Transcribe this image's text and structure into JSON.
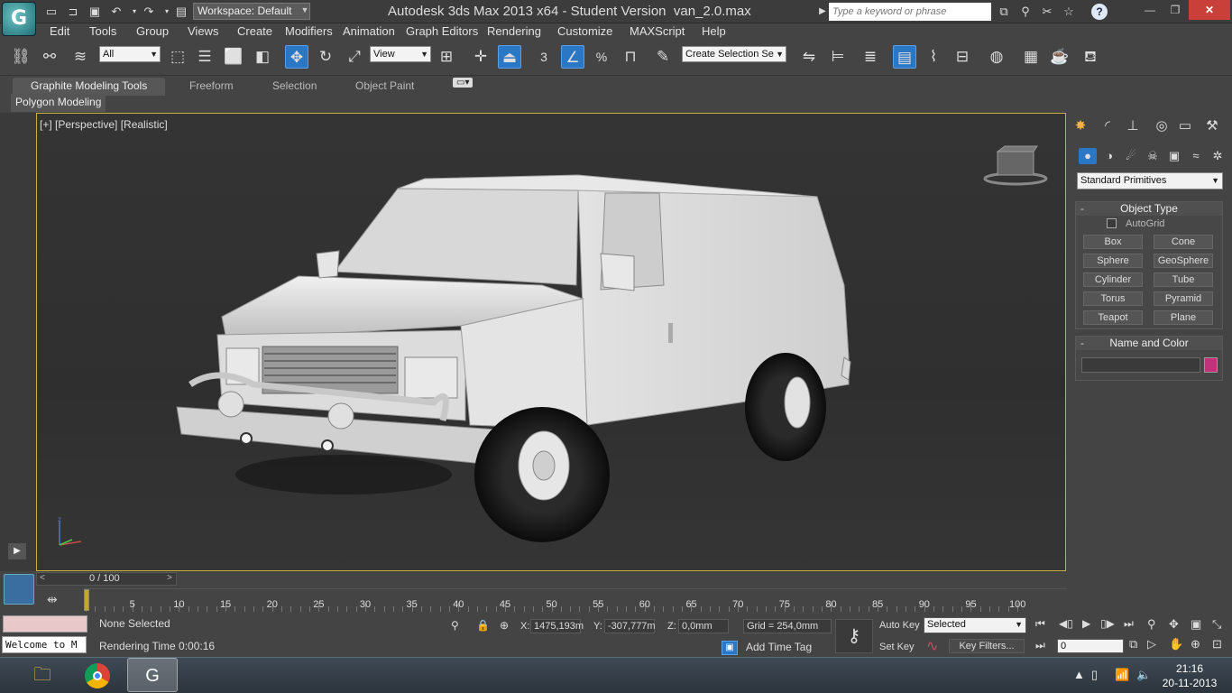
{
  "title_bar": {
    "app_title": "Autodesk 3ds Max  2013 x64  - Student Version",
    "file_name": "van_2.0.max",
    "workspace": "Workspace: Default",
    "search_placeholder": "Type a keyword or phrase",
    "help_icon": "?",
    "close": "✕",
    "maximize": "❐",
    "minimize": "—"
  },
  "menu": [
    "Edit",
    "Tools",
    "Group",
    "Views",
    "Create",
    "Modifiers",
    "Animation",
    "Graph Editors",
    "Rendering",
    "Customize",
    "MAXScript",
    "Help"
  ],
  "toolbar": {
    "filter_value": "All",
    "ref_coord_value": "View",
    "snap_label": "3",
    "selection_set_placeholder": "Create Selection Se"
  },
  "ribbon": {
    "tabs": [
      "Graphite Modeling Tools",
      "Freeform",
      "Selection",
      "Object Paint"
    ],
    "active_panel": "Polygon Modeling"
  },
  "viewport": {
    "label": "[+] [Perspective] [Realistic]",
    "axis_z": "z"
  },
  "command_panel": {
    "category": "Standard Primitives",
    "object_type_title": "Object Type",
    "autogrid_label": "AutoGrid",
    "primitives": [
      "Box",
      "Cone",
      "Sphere",
      "GeoSphere",
      "Cylinder",
      "Tube",
      "Torus",
      "Pyramid",
      "Teapot",
      "Plane"
    ],
    "name_color_title": "Name and Color",
    "object_color": "#c2327a"
  },
  "timeline": {
    "frame_label": "0 / 100",
    "ticks": [
      "5",
      "10",
      "15",
      "20",
      "25",
      "30",
      "35",
      "40",
      "45",
      "50",
      "55",
      "60",
      "65",
      "70",
      "75",
      "80",
      "85",
      "90",
      "95",
      "100"
    ]
  },
  "status": {
    "selection": "None Selected",
    "prompt": "Rendering Time  0:00:16",
    "maxscript": "Welcome to M",
    "x_label": "X:",
    "x_value": "1475,193m",
    "y_label": "Y:",
    "y_value": "-307,777m",
    "z_label": "Z:",
    "z_value": "0,0mm",
    "grid": "Grid = 254,0mm",
    "add_time_tag": "Add Time Tag",
    "auto_key": "Auto Key",
    "set_key": "Set Key",
    "key_mode": "Selected",
    "key_filters": "Key Filters...",
    "current_frame": "0"
  },
  "taskbar": {
    "time": "21:16",
    "date": "20-11-2013"
  }
}
